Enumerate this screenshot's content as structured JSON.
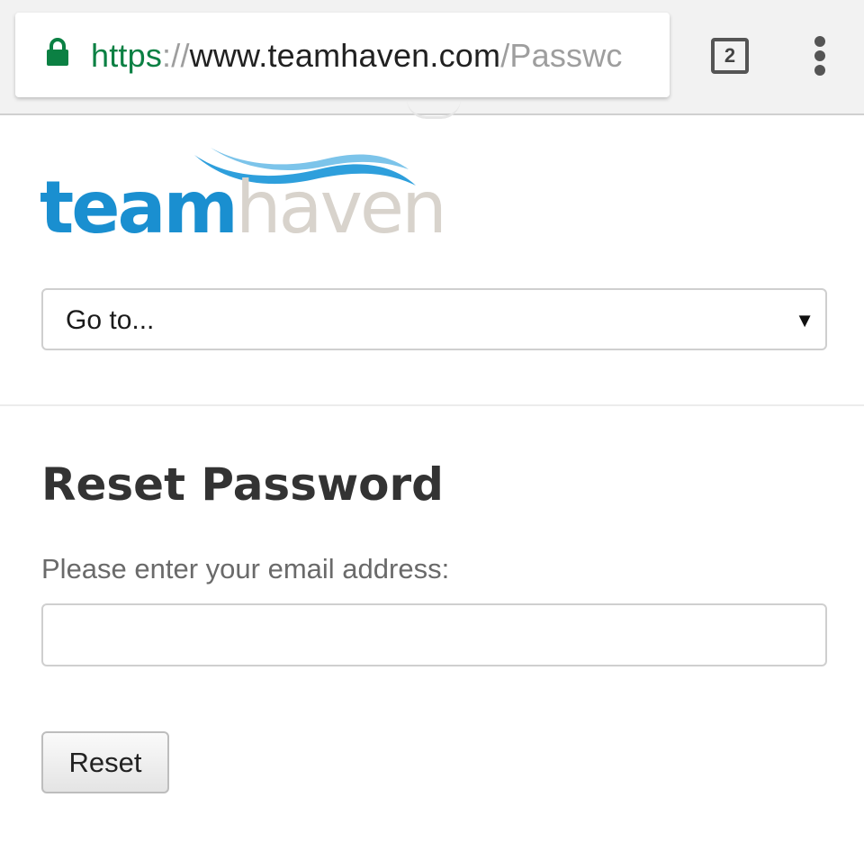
{
  "browser": {
    "url_scheme": "https",
    "url_separator": "://",
    "url_host": "www.teamhaven.com",
    "url_path": "/Passwc",
    "tab_count": "2",
    "lock_icon": "lock-icon",
    "menu_icon": "more-vert-icon",
    "colors": {
      "secure": "#0b8043",
      "chrome_bg": "#f2f2f2"
    }
  },
  "logo": {
    "part1": "team",
    "part2": "haven",
    "colors": {
      "team": "#1a8fd0",
      "haven": "#d8d3cc",
      "wave": "#2e9fdc"
    }
  },
  "nav": {
    "goto_selected": "Go to...",
    "arrow_icon": "dropdown-arrow-icon"
  },
  "main": {
    "title": "Reset Password",
    "email_label": "Please enter your email address:",
    "email_value": "",
    "reset_label": "Reset"
  }
}
